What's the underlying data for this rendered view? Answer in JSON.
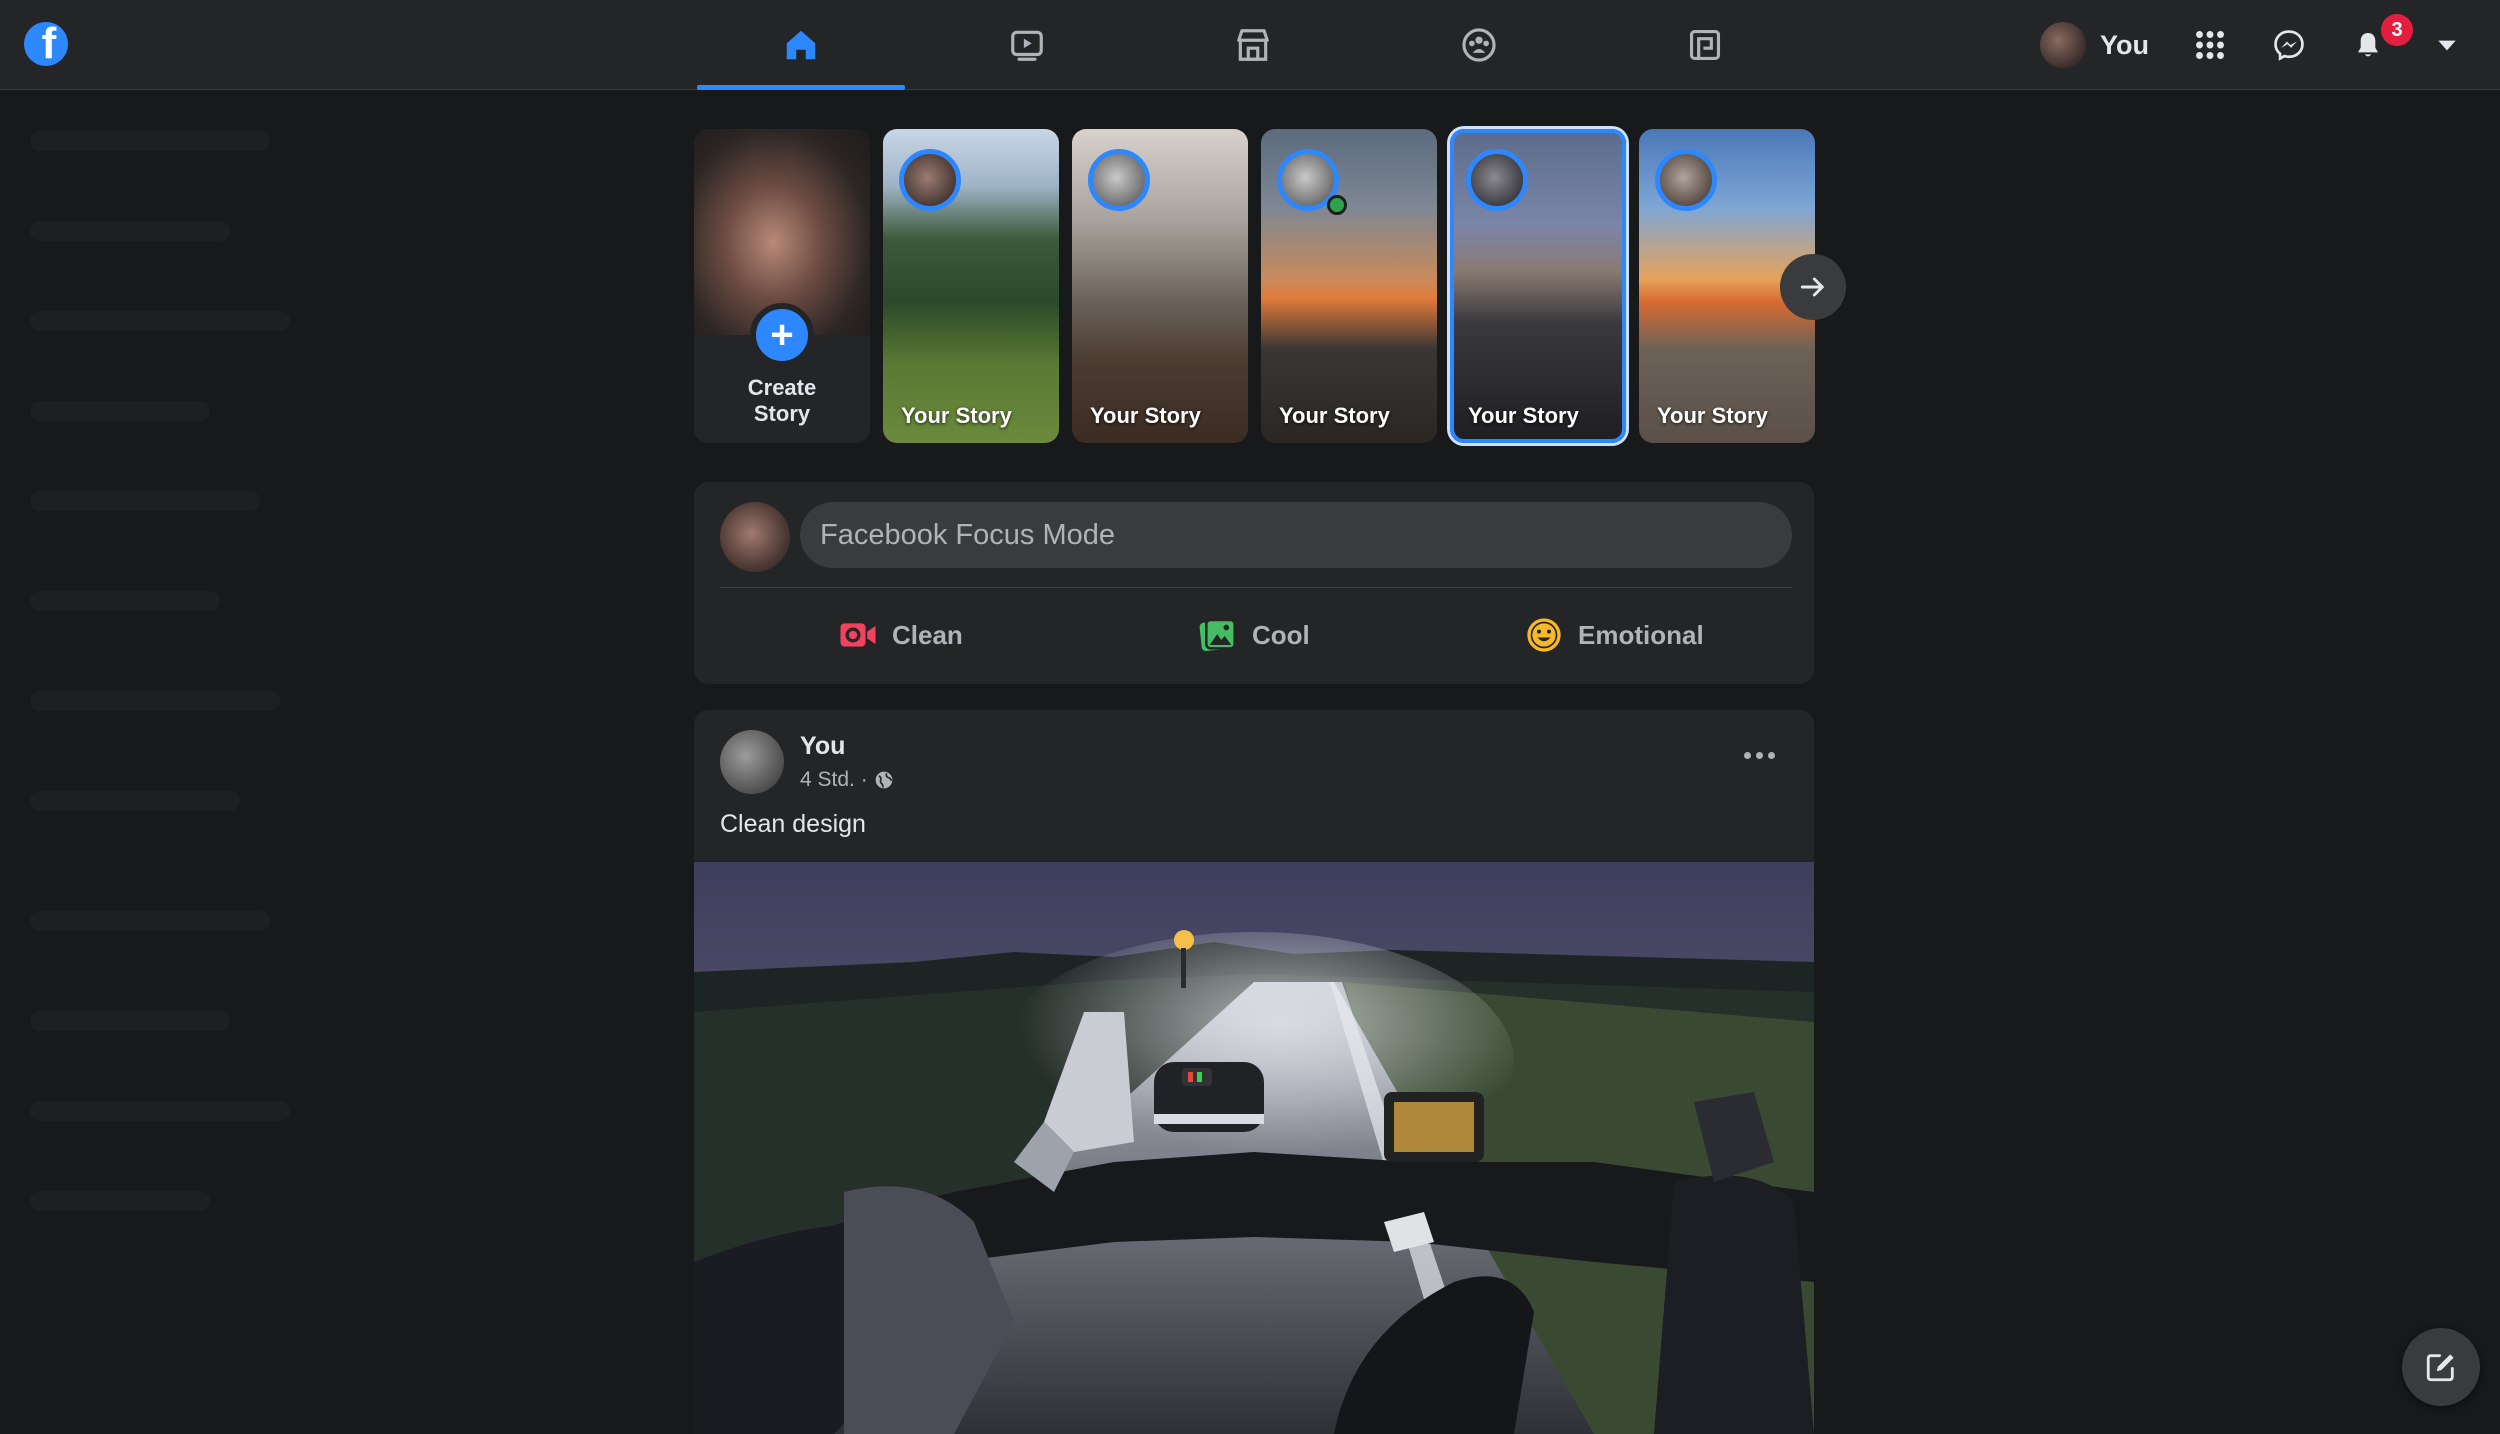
{
  "header": {
    "profile_name": "You",
    "notification_count": "3",
    "logo_letter": "f",
    "nav_tabs": [
      {
        "name": "home",
        "icon": "home-icon",
        "active": true
      },
      {
        "name": "watch",
        "icon": "video-icon",
        "active": false
      },
      {
        "name": "marketplace",
        "icon": "store-icon",
        "active": false
      },
      {
        "name": "groups",
        "icon": "groups-icon",
        "active": false
      },
      {
        "name": "gaming",
        "icon": "gaming-icon",
        "active": false
      }
    ],
    "right_icons": [
      "menu-grid-icon",
      "messenger-icon",
      "bell-icon",
      "caret-down-icon"
    ]
  },
  "stories": {
    "create_plus": "+",
    "create_label_line1": "Create",
    "create_label_line2": "Story",
    "items": [
      {
        "label": "Your Story"
      },
      {
        "label": "Your Story"
      },
      {
        "label": "Your Story"
      },
      {
        "label": "Your Story"
      },
      {
        "label": "Your Story"
      }
    ]
  },
  "composer": {
    "placeholder": "Facebook Focus Mode",
    "actions": [
      {
        "label": "Clean",
        "icon": "live-video-icon",
        "color": "#f3425f"
      },
      {
        "label": "Cool",
        "icon": "photo-icon",
        "color": "#45bd62"
      },
      {
        "label": "Emotional",
        "icon": "smiley-icon",
        "color": "#f7b928"
      }
    ]
  },
  "post": {
    "author": "You",
    "time": "4 Std. ·",
    "privacy_icon": "globe-icon",
    "text": "Clean design"
  },
  "colors": {
    "accent": "#2d88ff",
    "background": "#18191a",
    "surface": "#242526",
    "badge": "#e41e3f"
  }
}
